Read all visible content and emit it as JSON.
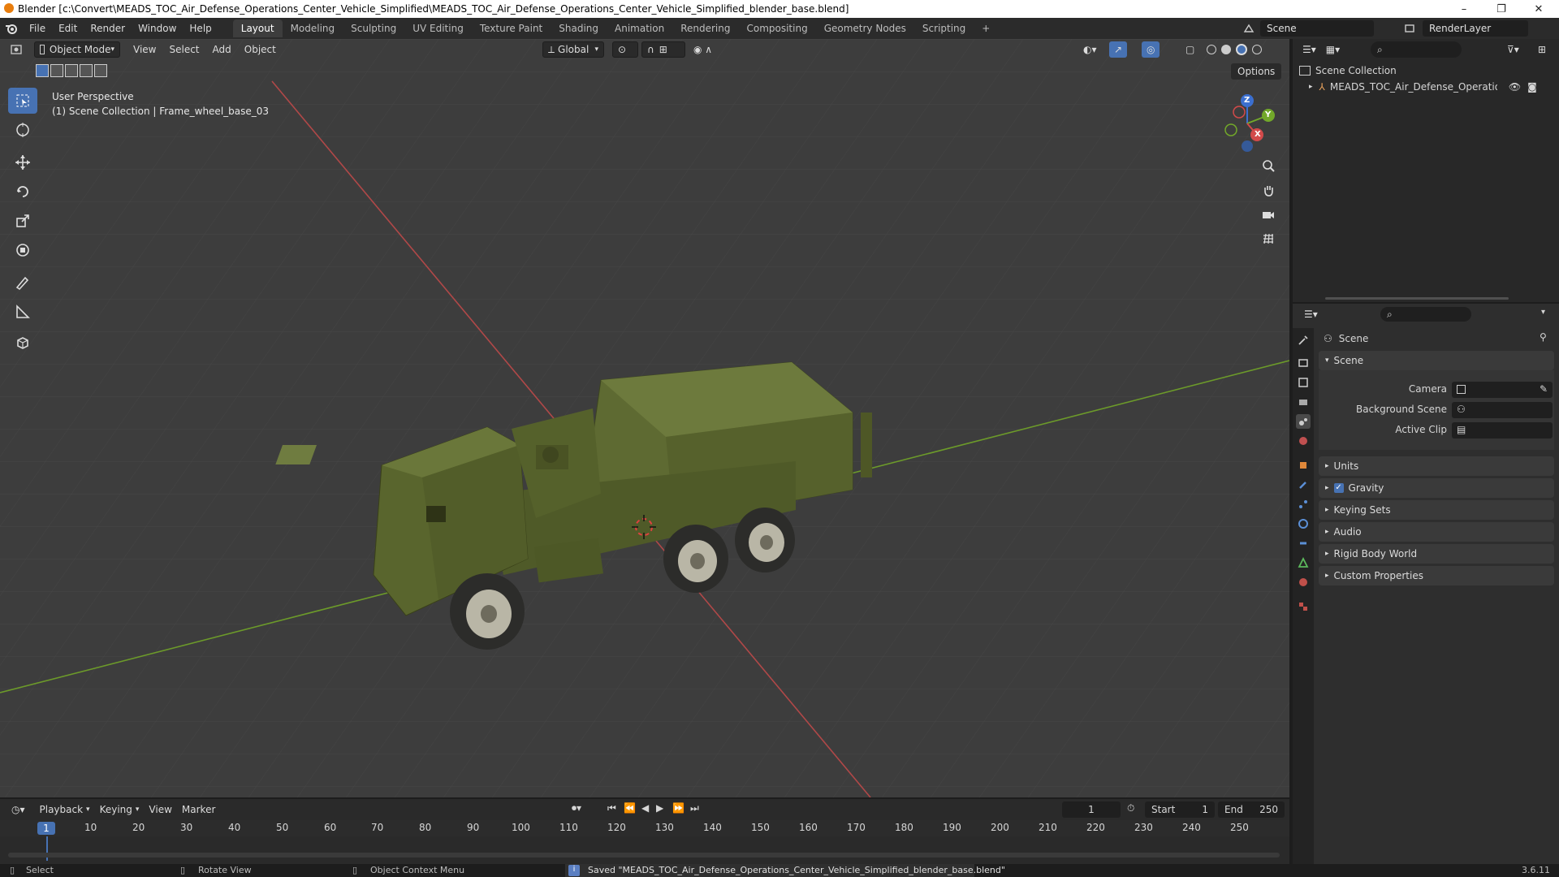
{
  "window": {
    "title": "Blender [c:\\Convert\\MEADS_TOC_Air_Defense_Operations_Center_Vehicle_Simplified\\MEADS_TOC_Air_Defense_Operations_Center_Vehicle_Simplified_blender_base.blend]",
    "controls": [
      "–",
      "❐",
      "✕"
    ]
  },
  "menubar": {
    "menus": [
      "File",
      "Edit",
      "Render",
      "Window",
      "Help"
    ],
    "workspaces": [
      "Layout",
      "Modeling",
      "Sculpting",
      "UV Editing",
      "Texture Paint",
      "Shading",
      "Animation",
      "Rendering",
      "Compositing",
      "Geometry Nodes",
      "Scripting"
    ],
    "active_workspace": "Layout",
    "add_tab": "+",
    "scene_name": "Scene",
    "view_layer": "RenderLayer"
  },
  "viewport": {
    "mode": "Object Mode",
    "menus": [
      "View",
      "Select",
      "Add",
      "Object"
    ],
    "orientation": "Global",
    "options_label": "Options",
    "overlay_title": "User Perspective",
    "overlay_subtitle": "(1) Scene Collection | Frame_wheel_base_03",
    "gizmo_axes": [
      "X",
      "Y",
      "Z"
    ]
  },
  "outliner": {
    "root": "Scene Collection",
    "items": [
      {
        "label": "MEADS_TOC_Air_Defense_Operations_C"
      }
    ]
  },
  "properties": {
    "context": "Scene",
    "panel_scene": "Scene",
    "fields": [
      {
        "label": "Camera"
      },
      {
        "label": "Background Scene"
      },
      {
        "label": "Active Clip"
      }
    ],
    "collapsed_panels": [
      "Units",
      "Gravity",
      "Keying Sets",
      "Audio",
      "Rigid Body World",
      "Custom Properties"
    ],
    "gravity_checked": true
  },
  "timeline": {
    "menus": [
      "Playback",
      "Keying",
      "View",
      "Marker"
    ],
    "current_frame": "1",
    "start_label": "Start",
    "start": "1",
    "end_label": "End",
    "end": "250",
    "ruler": [
      "1",
      "10",
      "20",
      "30",
      "40",
      "50",
      "60",
      "70",
      "80",
      "90",
      "100",
      "110",
      "120",
      "130",
      "140",
      "150",
      "160",
      "170",
      "180",
      "190",
      "200",
      "210",
      "220",
      "230",
      "240",
      "250"
    ]
  },
  "statusbar": {
    "select": "Select",
    "rotate": "Rotate View",
    "context_menu": "Object Context Menu",
    "message": "Saved \"MEADS_TOC_Air_Defense_Operations_Center_Vehicle_Simplified_blender_base.blend\"",
    "version": "3.6.11"
  },
  "colors": {
    "accent": "#4772b3",
    "x_axis": "#c84545",
    "y_axis": "#6c9a2a",
    "vehicle": "#5e6a32"
  }
}
